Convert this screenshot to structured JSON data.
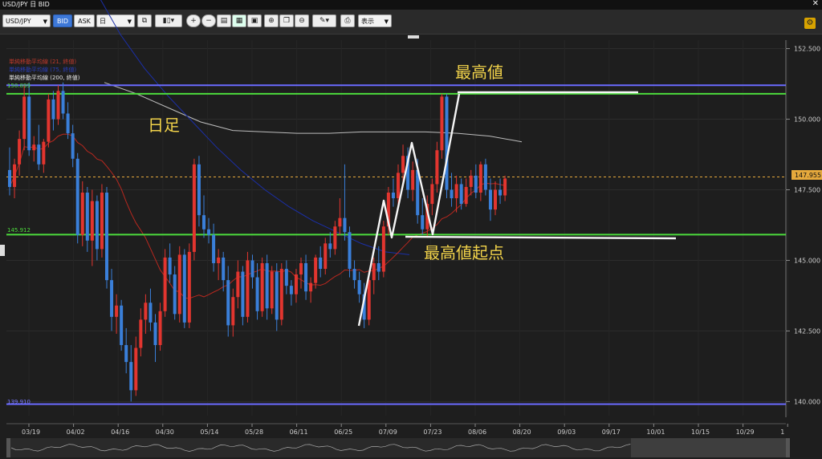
{
  "window": {
    "title": "USD/JPY 日 BID",
    "close_glyph": "✕"
  },
  "toolbar": {
    "symbol": "USD/JPY",
    "bid_label": "BID",
    "ask_label": "ASK",
    "timeframe": "日",
    "display_label": "表示",
    "caret": "▼",
    "icons": [
      "link-icon",
      "candlestick-icon",
      "zoom-in-icon",
      "zoom-out-icon",
      "window-icon",
      "layout-icon",
      "calendar-icon",
      "add-chart-icon",
      "copy-chart-icon",
      "remove-chart-icon",
      "pen-icon",
      "screenshot-icon"
    ]
  },
  "price_axis": {
    "ticks": [
      "152.500",
      "150.000",
      "147.500",
      "145.000",
      "142.500",
      "140.000"
    ],
    "current_price": "147.955"
  },
  "time_axis": {
    "labels": [
      "03/19",
      "04/02",
      "04/16",
      "04/30",
      "05/14",
      "05/28",
      "06/11",
      "06/25",
      "07/09",
      "07/23",
      "08/06",
      "08/20",
      "09/03",
      "09/17",
      "10/01",
      "10/15",
      "10/29",
      "1"
    ]
  },
  "indicators": {
    "ma21": "単純移動平均線 (21, 終値)",
    "ma_blue": "単純移動平均線 (75, 終値)",
    "ma200": "単純移動平均線 (200, 終値)"
  },
  "levels": {
    "upper_green": "150.899",
    "lower_green": "145.912",
    "bottom_purple": "139.910"
  },
  "annotations": {
    "high": "最高値",
    "daily": "日足",
    "high_start": "最高値起点"
  },
  "colors": {
    "background": "#1e1e1e",
    "bull": "#e2352f",
    "bear": "#3a7fd9",
    "level_green": "#4cdc3c",
    "level_purple": "#6a6aff",
    "ma21": "#b8281f",
    "ma_blue": "#1b2fa8",
    "ma200": "#bdbdbd",
    "annotation_text": "#f2d34a",
    "current_price": "#e6a93c"
  },
  "chart_data": {
    "type": "candlestick",
    "ylim": [
      139.5,
      152.8
    ],
    "candles": [
      {
        "o": 148.2,
        "h": 149.0,
        "l": 147.3,
        "c": 147.6
      },
      {
        "o": 147.6,
        "h": 148.6,
        "l": 147.2,
        "c": 148.4
      },
      {
        "o": 148.4,
        "h": 149.6,
        "l": 148.0,
        "c": 149.3
      },
      {
        "o": 149.3,
        "h": 151.2,
        "l": 148.9,
        "c": 150.8
      },
      {
        "o": 150.8,
        "h": 151.3,
        "l": 148.7,
        "c": 148.9
      },
      {
        "o": 148.9,
        "h": 149.4,
        "l": 148.5,
        "c": 149.1
      },
      {
        "o": 149.1,
        "h": 149.8,
        "l": 148.2,
        "c": 148.4
      },
      {
        "o": 148.4,
        "h": 149.3,
        "l": 148.1,
        "c": 149.2
      },
      {
        "o": 149.2,
        "h": 150.9,
        "l": 149.0,
        "c": 150.7
      },
      {
        "o": 150.7,
        "h": 151.0,
        "l": 149.6,
        "c": 150.0
      },
      {
        "o": 150.0,
        "h": 151.2,
        "l": 149.8,
        "c": 151.0
      },
      {
        "o": 151.0,
        "h": 151.3,
        "l": 150.0,
        "c": 150.2
      },
      {
        "o": 150.2,
        "h": 150.6,
        "l": 149.3,
        "c": 149.5
      },
      {
        "o": 149.5,
        "h": 149.8,
        "l": 148.3,
        "c": 148.6
      },
      {
        "o": 148.6,
        "h": 148.8,
        "l": 145.6,
        "c": 145.9
      },
      {
        "o": 145.9,
        "h": 147.8,
        "l": 145.5,
        "c": 147.4
      },
      {
        "o": 147.4,
        "h": 147.6,
        "l": 145.3,
        "c": 145.7
      },
      {
        "o": 145.7,
        "h": 147.5,
        "l": 144.8,
        "c": 147.1
      },
      {
        "o": 147.1,
        "h": 147.3,
        "l": 145.0,
        "c": 145.4
      },
      {
        "o": 145.4,
        "h": 147.7,
        "l": 145.1,
        "c": 147.4
      },
      {
        "o": 147.4,
        "h": 147.6,
        "l": 144.0,
        "c": 144.3
      },
      {
        "o": 144.3,
        "h": 144.7,
        "l": 142.5,
        "c": 143.0
      },
      {
        "o": 143.0,
        "h": 143.8,
        "l": 142.4,
        "c": 143.4
      },
      {
        "o": 143.4,
        "h": 143.6,
        "l": 141.8,
        "c": 142.0
      },
      {
        "o": 142.0,
        "h": 142.6,
        "l": 141.0,
        "c": 141.4
      },
      {
        "o": 141.4,
        "h": 142.0,
        "l": 140.0,
        "c": 140.4
      },
      {
        "o": 140.4,
        "h": 142.3,
        "l": 140.2,
        "c": 141.9
      },
      {
        "o": 141.9,
        "h": 143.3,
        "l": 141.6,
        "c": 142.9
      },
      {
        "o": 142.9,
        "h": 143.8,
        "l": 142.4,
        "c": 143.5
      },
      {
        "o": 143.5,
        "h": 144.0,
        "l": 142.5,
        "c": 142.8
      },
      {
        "o": 142.8,
        "h": 143.1,
        "l": 141.4,
        "c": 142.0
      },
      {
        "o": 142.0,
        "h": 143.5,
        "l": 141.8,
        "c": 143.2
      },
      {
        "o": 143.2,
        "h": 145.4,
        "l": 143.0,
        "c": 145.1
      },
      {
        "o": 145.1,
        "h": 145.6,
        "l": 144.2,
        "c": 144.5
      },
      {
        "o": 144.5,
        "h": 144.8,
        "l": 142.9,
        "c": 143.1
      },
      {
        "o": 143.1,
        "h": 145.5,
        "l": 142.8,
        "c": 145.2
      },
      {
        "o": 145.2,
        "h": 145.4,
        "l": 142.6,
        "c": 142.8
      },
      {
        "o": 142.8,
        "h": 145.6,
        "l": 142.6,
        "c": 145.3
      },
      {
        "o": 145.3,
        "h": 148.6,
        "l": 145.0,
        "c": 148.4
      },
      {
        "o": 148.4,
        "h": 148.7,
        "l": 146.2,
        "c": 146.6
      },
      {
        "o": 146.6,
        "h": 147.3,
        "l": 145.8,
        "c": 146.1
      },
      {
        "o": 146.1,
        "h": 146.5,
        "l": 145.6,
        "c": 145.9
      },
      {
        "o": 145.9,
        "h": 146.3,
        "l": 144.6,
        "c": 144.9
      },
      {
        "o": 144.9,
        "h": 145.4,
        "l": 144.3,
        "c": 145.1
      },
      {
        "o": 145.1,
        "h": 145.3,
        "l": 143.9,
        "c": 144.3
      },
      {
        "o": 144.3,
        "h": 144.8,
        "l": 142.3,
        "c": 142.7
      },
      {
        "o": 142.7,
        "h": 144.0,
        "l": 142.3,
        "c": 143.7
      },
      {
        "o": 143.7,
        "h": 145.0,
        "l": 143.3,
        "c": 144.6
      },
      {
        "o": 144.6,
        "h": 144.8,
        "l": 142.7,
        "c": 143.0
      },
      {
        "o": 143.0,
        "h": 145.3,
        "l": 142.8,
        "c": 145.0
      },
      {
        "o": 145.0,
        "h": 145.2,
        "l": 144.0,
        "c": 144.4
      },
      {
        "o": 144.4,
        "h": 144.9,
        "l": 142.9,
        "c": 143.2
      },
      {
        "o": 143.2,
        "h": 145.1,
        "l": 143.0,
        "c": 144.9
      },
      {
        "o": 144.9,
        "h": 145.2,
        "l": 142.9,
        "c": 143.3
      },
      {
        "o": 143.3,
        "h": 144.8,
        "l": 143.1,
        "c": 144.6
      },
      {
        "o": 144.6,
        "h": 144.9,
        "l": 142.5,
        "c": 142.9
      },
      {
        "o": 142.9,
        "h": 144.9,
        "l": 142.7,
        "c": 144.7
      },
      {
        "o": 144.7,
        "h": 145.0,
        "l": 143.8,
        "c": 144.1
      },
      {
        "o": 144.1,
        "h": 144.3,
        "l": 143.4,
        "c": 143.8
      },
      {
        "o": 143.8,
        "h": 144.7,
        "l": 143.5,
        "c": 144.5
      },
      {
        "o": 144.5,
        "h": 145.1,
        "l": 144.0,
        "c": 144.9
      },
      {
        "o": 144.9,
        "h": 145.2,
        "l": 143.6,
        "c": 143.9
      },
      {
        "o": 143.9,
        "h": 144.4,
        "l": 143.5,
        "c": 144.2
      },
      {
        "o": 144.2,
        "h": 145.2,
        "l": 144.0,
        "c": 145.1
      },
      {
        "o": 145.1,
        "h": 145.5,
        "l": 144.4,
        "c": 144.7
      },
      {
        "o": 144.7,
        "h": 145.8,
        "l": 144.5,
        "c": 145.6
      },
      {
        "o": 145.6,
        "h": 146.0,
        "l": 145.1,
        "c": 145.4
      },
      {
        "o": 145.4,
        "h": 146.4,
        "l": 145.2,
        "c": 146.2
      },
      {
        "o": 146.2,
        "h": 147.2,
        "l": 145.9,
        "c": 146.5
      },
      {
        "o": 146.5,
        "h": 148.4,
        "l": 145.7,
        "c": 146.0
      },
      {
        "o": 146.0,
        "h": 146.2,
        "l": 144.4,
        "c": 144.7
      },
      {
        "o": 144.7,
        "h": 145.0,
        "l": 144.0,
        "c": 144.3
      },
      {
        "o": 144.3,
        "h": 144.6,
        "l": 143.5,
        "c": 143.8
      },
      {
        "o": 143.8,
        "h": 144.2,
        "l": 142.6,
        "c": 142.9
      },
      {
        "o": 142.9,
        "h": 144.5,
        "l": 142.7,
        "c": 144.3
      },
      {
        "o": 144.3,
        "h": 145.1,
        "l": 143.8,
        "c": 144.9
      },
      {
        "o": 144.9,
        "h": 145.5,
        "l": 144.3,
        "c": 144.6
      },
      {
        "o": 144.6,
        "h": 146.4,
        "l": 144.4,
        "c": 146.2
      },
      {
        "o": 146.2,
        "h": 147.6,
        "l": 145.9,
        "c": 147.4
      },
      {
        "o": 147.4,
        "h": 147.9,
        "l": 146.9,
        "c": 147.2
      },
      {
        "o": 147.2,
        "h": 148.4,
        "l": 146.9,
        "c": 148.1
      },
      {
        "o": 148.1,
        "h": 149.1,
        "l": 147.7,
        "c": 148.7
      },
      {
        "o": 148.7,
        "h": 149.0,
        "l": 147.2,
        "c": 147.5
      },
      {
        "o": 147.5,
        "h": 148.5,
        "l": 147.1,
        "c": 148.2
      },
      {
        "o": 148.2,
        "h": 148.6,
        "l": 146.3,
        "c": 146.6
      },
      {
        "o": 146.6,
        "h": 147.2,
        "l": 145.9,
        "c": 146.1
      },
      {
        "o": 146.1,
        "h": 147.3,
        "l": 145.8,
        "c": 147.0
      },
      {
        "o": 147.0,
        "h": 147.9,
        "l": 146.6,
        "c": 147.7
      },
      {
        "o": 147.7,
        "h": 149.2,
        "l": 147.4,
        "c": 148.9
      },
      {
        "o": 148.9,
        "h": 150.9,
        "l": 148.6,
        "c": 150.8
      },
      {
        "o": 150.8,
        "h": 150.9,
        "l": 147.2,
        "c": 147.5
      },
      {
        "o": 147.5,
        "h": 148.1,
        "l": 146.9,
        "c": 147.2
      },
      {
        "o": 147.2,
        "h": 148.0,
        "l": 146.7,
        "c": 147.7
      },
      {
        "o": 147.7,
        "h": 147.9,
        "l": 146.8,
        "c": 147.0
      },
      {
        "o": 147.0,
        "h": 147.9,
        "l": 146.9,
        "c": 147.6
      },
      {
        "o": 147.6,
        "h": 148.2,
        "l": 147.3,
        "c": 148.0
      },
      {
        "o": 148.0,
        "h": 148.4,
        "l": 147.2,
        "c": 147.4
      },
      {
        "o": 147.4,
        "h": 148.5,
        "l": 147.1,
        "c": 148.4
      },
      {
        "o": 148.4,
        "h": 148.6,
        "l": 147.3,
        "c": 147.5
      },
      {
        "o": 147.5,
        "h": 147.9,
        "l": 146.4,
        "c": 146.8
      },
      {
        "o": 146.8,
        "h": 147.8,
        "l": 146.6,
        "c": 147.5
      },
      {
        "o": 147.5,
        "h": 147.9,
        "l": 147.0,
        "c": 147.3
      },
      {
        "o": 147.3,
        "h": 148.0,
        "l": 147.1,
        "c": 147.9
      }
    ]
  }
}
